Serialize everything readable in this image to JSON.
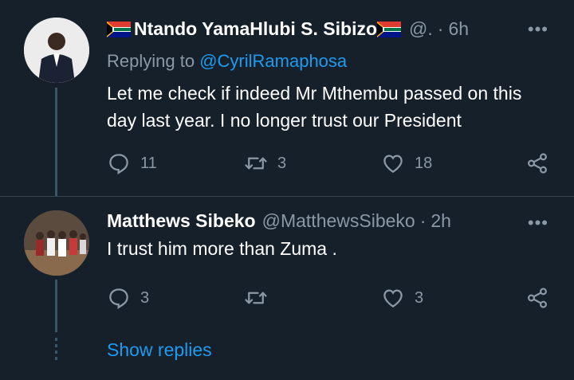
{
  "tweets": [
    {
      "display_name": "Ntando YamaHlubi S. Sibizo",
      "handle": "@.",
      "separator": "·",
      "time": "6h",
      "replying_label": "Replying to",
      "replying_to": "@CyrilRamaphosa",
      "text": "Let me check if indeed Mr Mthembu passed on this day last year. I no longer trust our President",
      "replies": "11",
      "retweets": "3",
      "likes": "18",
      "name_flags": "south-africa-flag"
    },
    {
      "display_name": "Matthews Sibeko",
      "handle": "@MatthewsSibeko",
      "separator": "·",
      "time": "2h",
      "text": "I trust him more than Zuma .",
      "replies": "3",
      "retweets": "",
      "likes": "3"
    }
  ],
  "show_replies": "Show replies",
  "more_glyph": "•••",
  "colors": {
    "background": "#15202b",
    "link": "#1d9bf0",
    "muted": "#8b98a5"
  }
}
